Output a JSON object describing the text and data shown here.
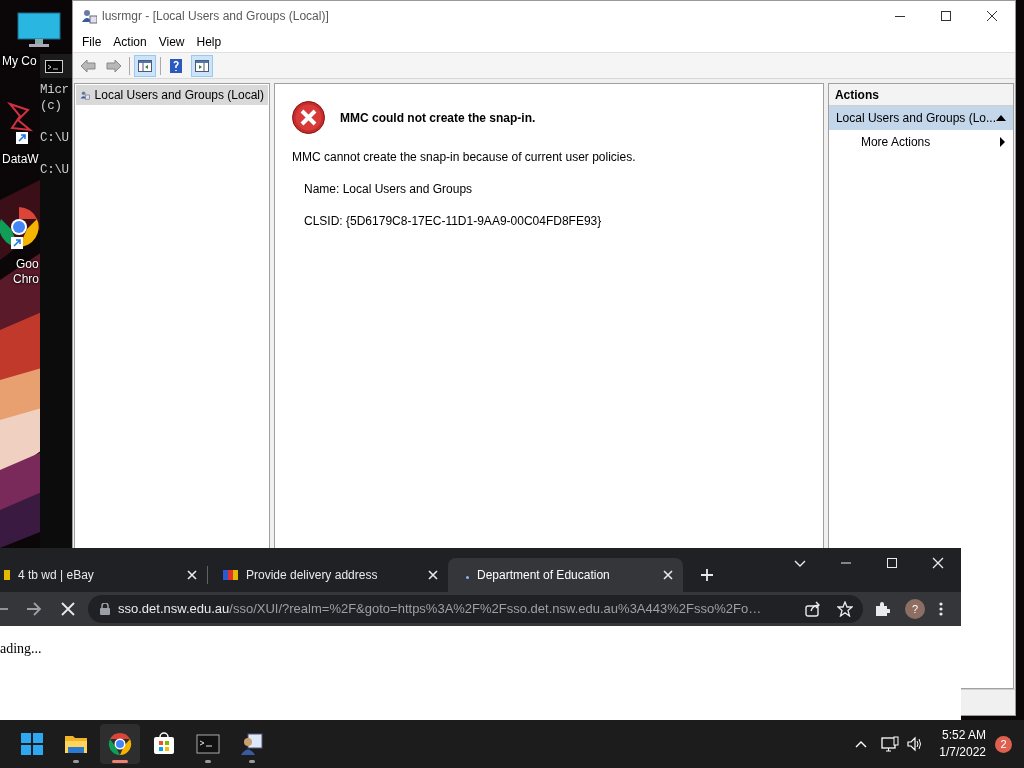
{
  "desktop_icons": [
    {
      "kind": "computer",
      "label_lines": [
        "My Co"
      ]
    },
    {
      "kind": "app",
      "label_lines": [
        "DataW"
      ]
    },
    {
      "kind": "browser",
      "label_lines": [
        "Goo",
        "Chro"
      ]
    }
  ],
  "console_window": {
    "lines": [
      "Micr",
      "(c)",
      "C:\\U",
      "C:\\U"
    ]
  },
  "mmc_window": {
    "title": "lusrmgr - [Local Users and Groups (Local)]",
    "menu": [
      "File",
      "Action",
      "View",
      "Help"
    ],
    "tree": [
      {
        "label": "Local Users and Groups (Local)",
        "selected": true
      }
    ],
    "error": {
      "title": "MMC could not create the snap-in.",
      "message": "MMC cannot create the snap-in because of current user policies.",
      "details": [
        "Name: Local Users and Groups",
        "CLSID: {5D6179C8-17EC-11D1-9AA9-00C04FD8FE93}"
      ]
    },
    "actions": {
      "header": "Actions",
      "sections": [
        {
          "title": "Local Users and Groups (Lo...",
          "expanded": true,
          "items": [
            "More Actions"
          ]
        }
      ]
    }
  },
  "browser": {
    "tabs": [
      {
        "title": "4 tb wd | eBay",
        "selected": false
      },
      {
        "title": "Provide delivery address",
        "selected": false
      },
      {
        "title": "Department of Education",
        "selected": true
      }
    ],
    "url_host": "sso.det.nsw.edu.au",
    "url_path": "/sso/XUI/?realm=%2F&goto=https%3A%2F%2Fsso.det.nsw.edu.au%3A443%2Fsso%2Fo…",
    "profile": "?",
    "page_text": "ading..."
  },
  "taskbar": {
    "apps": [
      {
        "kind": "start",
        "running": false,
        "selected": false
      },
      {
        "kind": "folder",
        "running": true,
        "selected": false
      },
      {
        "kind": "browser",
        "running": true,
        "selected": true
      },
      {
        "kind": "store",
        "running": false,
        "selected": false
      },
      {
        "kind": "terminal",
        "running": true,
        "selected": false
      },
      {
        "kind": "users",
        "running": true,
        "selected": false
      }
    ],
    "time": "5:52 AM",
    "date": "1/7/2022",
    "notifications": "2"
  }
}
